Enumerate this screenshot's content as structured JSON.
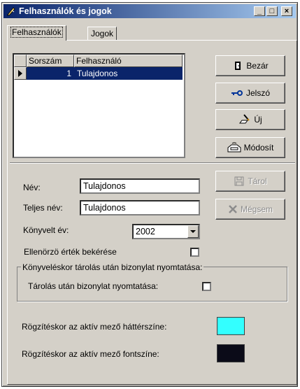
{
  "window": {
    "title": "Felhasználók és jogok",
    "buttons": {
      "minimize": "_",
      "maximize": "□",
      "close": "×"
    }
  },
  "tabs": [
    {
      "label": "Felhasználók",
      "active": true
    },
    {
      "label": "Jogok",
      "active": false
    }
  ],
  "grid": {
    "columns": [
      "Sorszám",
      "Felhasználó"
    ],
    "rows": [
      {
        "sorszam": "1",
        "felhasznalo": "Tulajdonos",
        "selected": true
      }
    ]
  },
  "actions": {
    "close_label": "Bezár",
    "password_label": "Jelszó",
    "new_label": "Új",
    "modify_label": "Módosít",
    "save_label": "Tárol",
    "cancel_label": "Mégsem"
  },
  "form": {
    "name_label": "Név:",
    "name_value": "Tulajdonos",
    "fullname_label": "Teljes név:",
    "fullname_value": "Tulajdonos",
    "year_label": "Könyvelt év:",
    "year_value": "2002",
    "checksum_label": "Ellenörzö érték bekérése",
    "checksum_checked": false,
    "print_group_title": "Könyveléskor tárolás után bizonylat nyomtatása:",
    "print_label": "Tárolás után bizonylat nyomtatása:",
    "print_checked": false,
    "bg_color_label": "Rögzítéskor az aktív mező háttérszíne:",
    "bg_color": "#33ffff",
    "font_color_label": "Rögzítéskor az aktív mező fontszíne:",
    "font_color": "#0b0b18"
  },
  "colors": {
    "title_gradient_start": "#0a246a",
    "title_gradient_end": "#a6caf0",
    "selection": "#0a246a"
  }
}
